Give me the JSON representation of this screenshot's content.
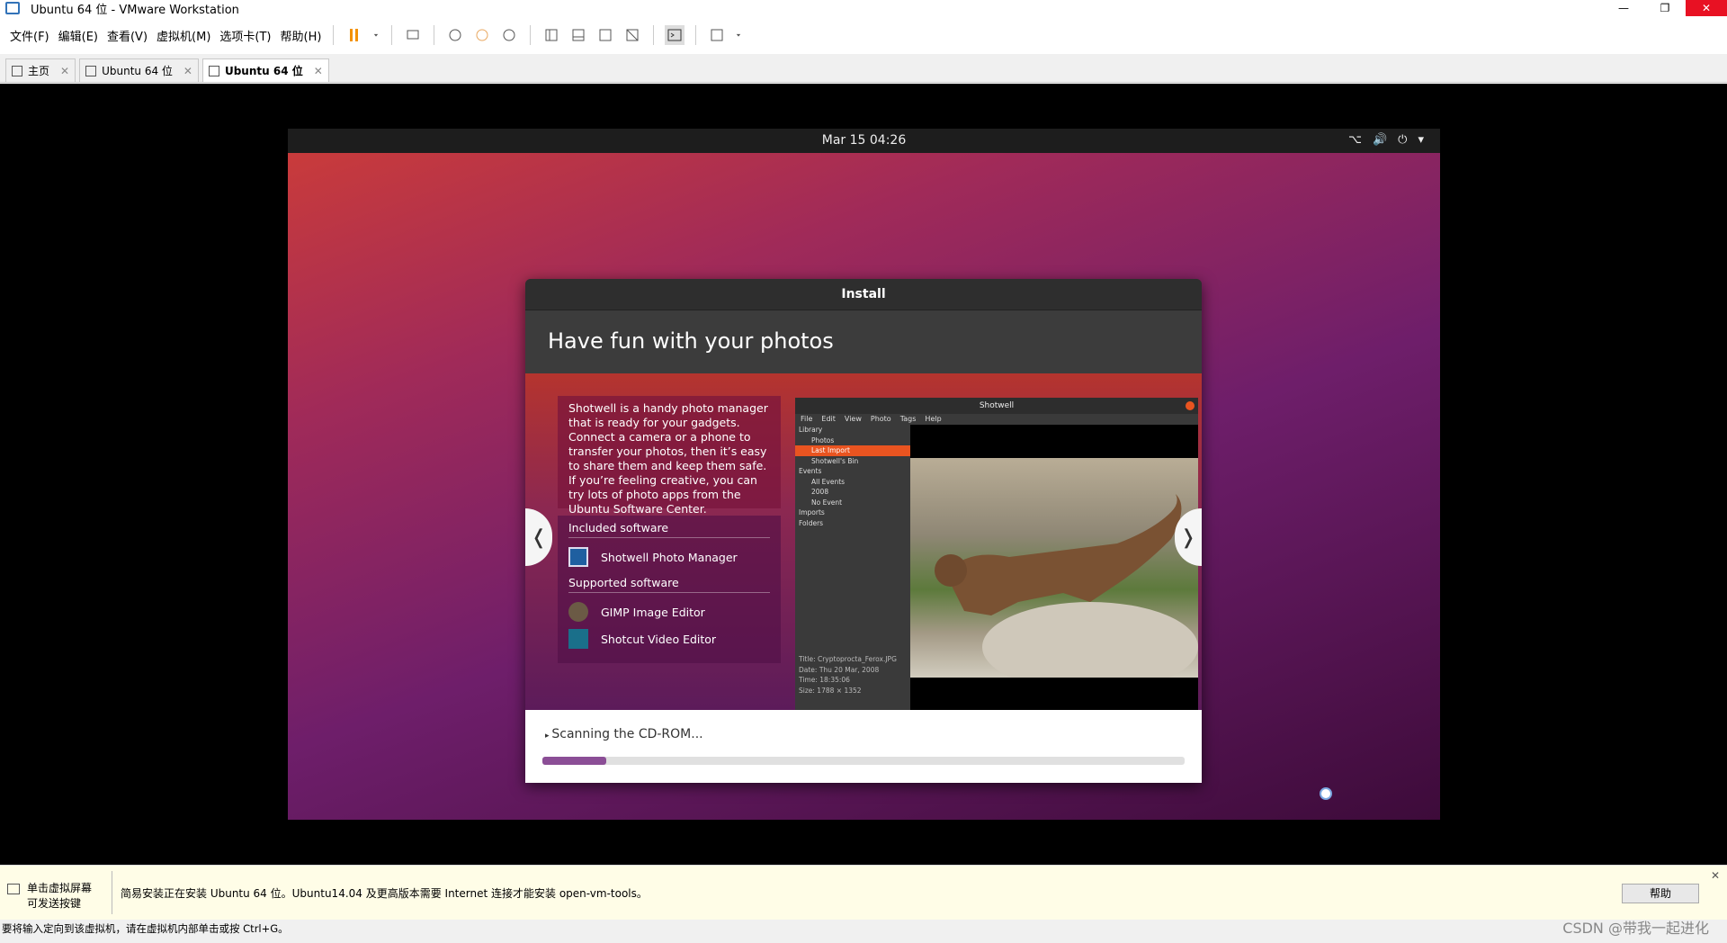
{
  "window": {
    "title": "Ubuntu 64 位 - VMware Workstation",
    "minimize": "—",
    "restore": "❐",
    "close": "✕"
  },
  "menu": [
    "文件(F)",
    "编辑(E)",
    "查看(V)",
    "虚拟机(M)",
    "选项卡(T)",
    "帮助(H)"
  ],
  "tabs": [
    {
      "label": "主页",
      "close": "✕"
    },
    {
      "label": "Ubuntu 64 位",
      "close": "✕"
    },
    {
      "label": "Ubuntu 64 位",
      "close": "✕"
    }
  ],
  "guest": {
    "clock": "Mar 15  04:26",
    "tray": {
      "network": "⌥",
      "volume": "🔊",
      "power": "⏻",
      "menu": "▾"
    }
  },
  "installer": {
    "title": "Install",
    "heading": "Have fun with your photos",
    "description": "Shotwell is a handy photo manager that is ready for your gadgets. Connect a camera or a phone to transfer your photos, then it’s easy to share them and keep them safe. If you’re feeling creative, you can try lots of photo apps from the Ubuntu Software Center.",
    "included_header": "Included software",
    "included": [
      "Shotwell Photo Manager"
    ],
    "supported_header": "Supported software",
    "supported": [
      "GIMP Image Editor",
      "Shotcut Video Editor"
    ],
    "prev": "❬",
    "next": "❭",
    "status": "Scanning the CD-ROM...",
    "progress_fraction": 0.1,
    "screenshot": {
      "title": "Shotwell",
      "menu": [
        "File",
        "Edit",
        "View",
        "Photo",
        "Tags",
        "Help"
      ],
      "sidebar": [
        "Library",
        "Photos",
        "Last Import",
        "Shotwell's Bin",
        "Events",
        "All Events",
        "2008",
        "No Event",
        "Imports",
        "Folders"
      ],
      "info": [
        "Title:   Cryptoprocta_Ferox.JPG",
        "Date:   Thu 20 Mar, 2008",
        "Time:   18:35:06",
        "Size:   1788 × 1352"
      ]
    }
  },
  "hint": {
    "left_line1": "单击虚拟屏幕",
    "left_line2": "可发送按键",
    "message": "简易安装正在安装 Ubuntu 64 位。Ubuntu14.04 及更高版本需要 Internet 连接才能安装 open-vm-tools。",
    "help_button": "帮助",
    "close": "✕"
  },
  "statusbar": {
    "text": "要将输入定向到该虚拟机，请在虚拟机内部单击或按 Ctrl+G。",
    "watermark": "CSDN @带我一起进化"
  }
}
